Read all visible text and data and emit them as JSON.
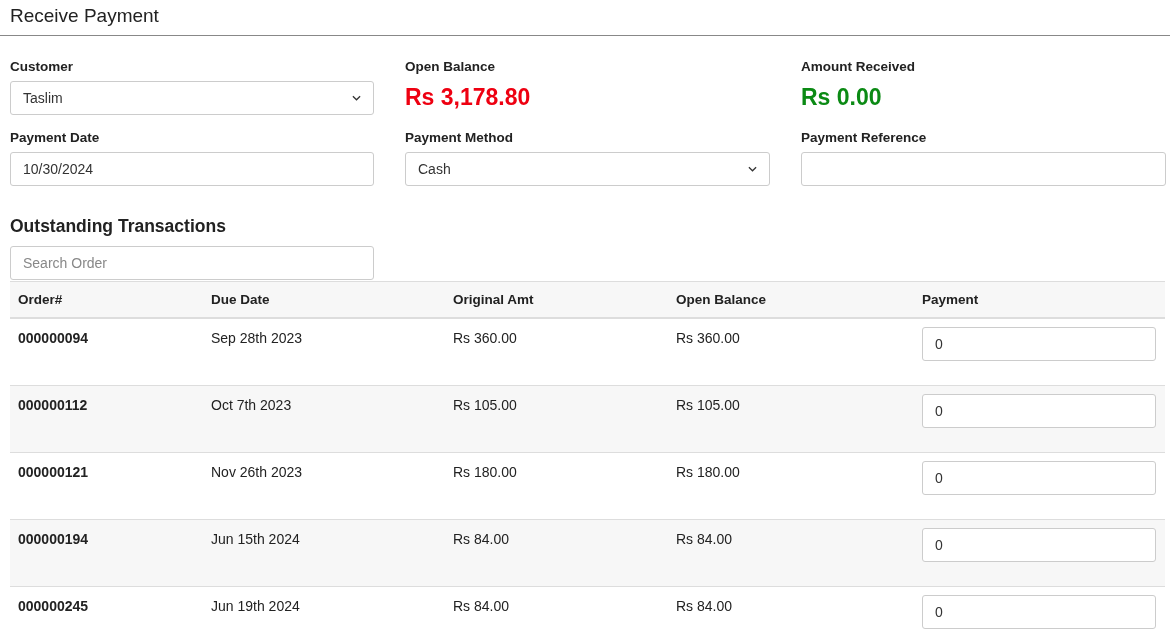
{
  "page": {
    "title": "Receive Payment"
  },
  "form": [
    {
      "kind": "select",
      "label": "Customer",
      "value": "Taslim"
    },
    {
      "kind": "amount",
      "label": "Open Balance",
      "value": "Rs 3,178.80",
      "color": "#ee0011"
    },
    {
      "kind": "amount",
      "label": "Amount Received",
      "value": "Rs 0.00",
      "color": "#0b8a14"
    },
    {
      "kind": "text",
      "label": "Payment Date",
      "value": "10/30/2024"
    },
    {
      "kind": "select",
      "label": "Payment Method",
      "value": "Cash"
    },
    {
      "kind": "text",
      "label": "Payment Reference"
    }
  ],
  "transactions": {
    "title": "Outstanding Transactions",
    "search": {
      "placeholder": "Search Order"
    },
    "columns": [
      "Order#",
      "Due Date",
      "Original Amt",
      "Open Balance",
      "Payment"
    ],
    "rows": [
      {
        "order": "000000094",
        "due_date": "Sep 28th 2023",
        "original_amt": "Rs 360.00",
        "open_balance": "Rs 360.00",
        "payment": "0"
      },
      {
        "order": "000000112",
        "due_date": "Oct 7th 2023",
        "original_amt": "Rs 105.00",
        "open_balance": "Rs 105.00",
        "payment": "0"
      },
      {
        "order": "000000121",
        "due_date": "Nov 26th 2023",
        "original_amt": "Rs 180.00",
        "open_balance": "Rs 180.00",
        "payment": "0"
      },
      {
        "order": "000000194",
        "due_date": "Jun 15th 2024",
        "original_amt": "Rs 84.00",
        "open_balance": "Rs 84.00",
        "payment": "0"
      },
      {
        "order": "000000245",
        "due_date": "Jun 19th 2024",
        "original_amt": "Rs 84.00",
        "open_balance": "Rs 84.00",
        "payment": "0"
      }
    ]
  }
}
